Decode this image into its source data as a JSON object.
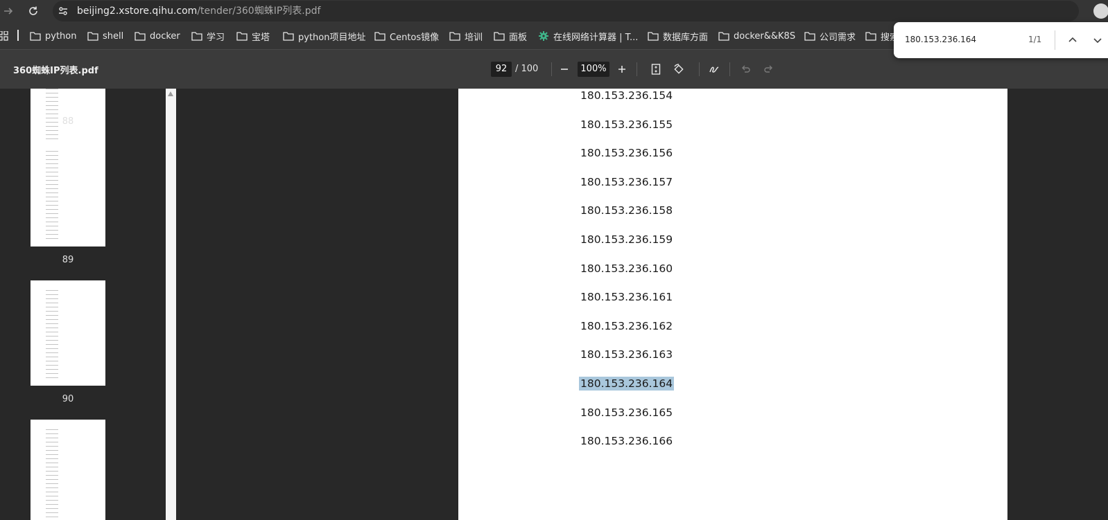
{
  "browser": {
    "url_host": "beijing2.xstore.qihu.com",
    "url_path": "/tender/360蜘蛛IP列表.pdf"
  },
  "bookmarks": [
    {
      "label": "python",
      "icon": "folder-icon"
    },
    {
      "label": "shell",
      "icon": "folder-icon"
    },
    {
      "label": "docker",
      "icon": "folder-icon"
    },
    {
      "label": "学习",
      "icon": "folder-icon"
    },
    {
      "label": "宝塔",
      "icon": "folder-icon"
    },
    {
      "label": "python项目地址",
      "icon": "folder-icon"
    },
    {
      "label": "Centos镜像",
      "icon": "folder-icon"
    },
    {
      "label": "培训",
      "icon": "folder-icon"
    },
    {
      "label": "面板",
      "icon": "folder-icon"
    },
    {
      "label": "在线网络计算器 | T...",
      "icon": "gear-site-icon"
    },
    {
      "label": "数据库方面",
      "icon": "folder-icon"
    },
    {
      "label": "docker&&K8S",
      "icon": "folder-icon"
    },
    {
      "label": "公司需求",
      "icon": "folder-icon"
    },
    {
      "label": "搜索",
      "icon": "folder-icon"
    }
  ],
  "pdf_toolbar": {
    "title": "360蜘蛛IP列表.pdf",
    "current_page": "92",
    "total_pages": "/ 100",
    "zoom": "100%"
  },
  "thumbnails": [
    {
      "page": "88"
    },
    {
      "page": "89"
    },
    {
      "page": "90"
    }
  ],
  "document": {
    "ips": [
      "180.153.236.154",
      "180.153.236.155",
      "180.153.236.156",
      "180.153.236.157",
      "180.153.236.158",
      "180.153.236.159",
      "180.153.236.160",
      "180.153.236.161",
      "180.153.236.162",
      "180.153.236.163",
      "180.153.236.164",
      "180.153.236.165",
      "180.153.236.166"
    ],
    "highlighted": "180.153.236.164"
  },
  "find_bar": {
    "query": "180.153.236.164",
    "count": "1/1"
  },
  "colors": {
    "highlight": "#a9c7dc",
    "toolbar": "#3b3b3b",
    "background": "#282828"
  }
}
